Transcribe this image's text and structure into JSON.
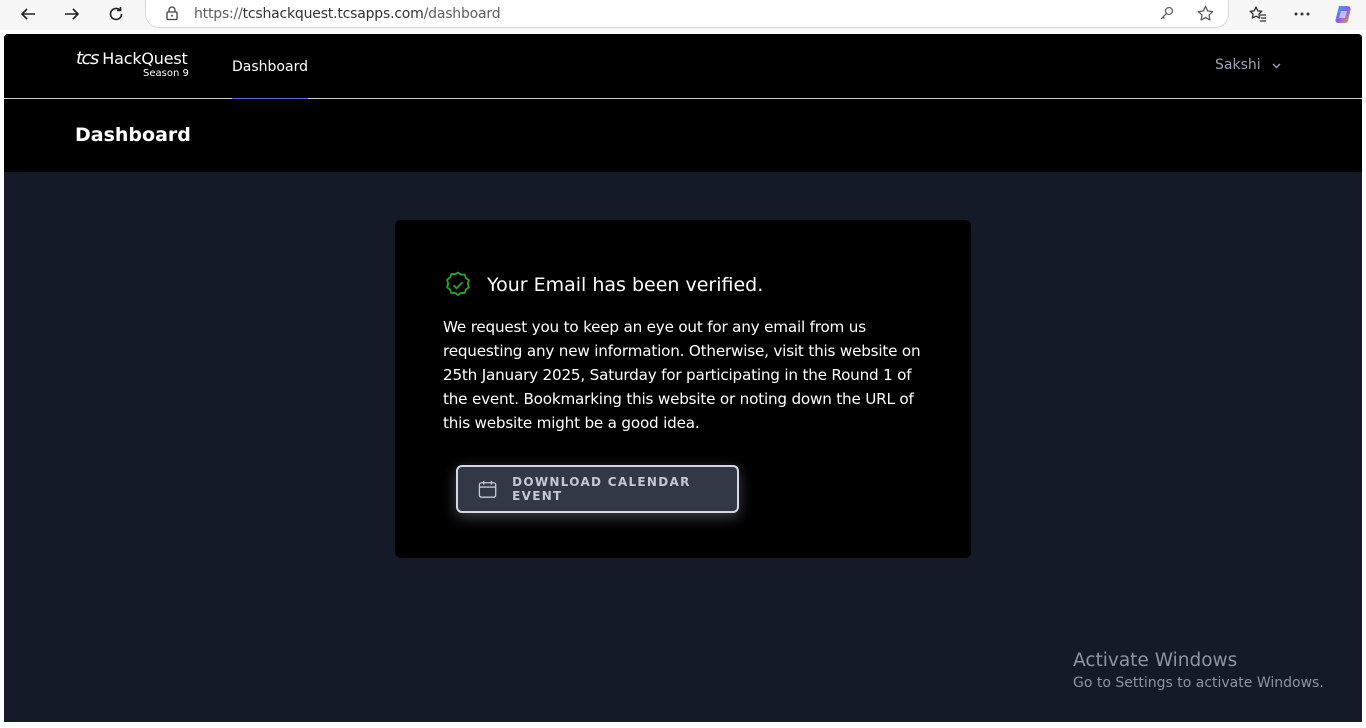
{
  "browser": {
    "url_prefix": "https://",
    "url_host": "tcshackquest.tcsapps.com",
    "url_path": "/dashboard"
  },
  "topnav": {
    "logo_brand": "tcs",
    "logo_name": "HackQuest",
    "logo_season": "Season 9",
    "nav_dashboard": "Dashboard",
    "user_name": "Sakshi"
  },
  "page": {
    "title": "Dashboard"
  },
  "card": {
    "title": "Your Email has been verified.",
    "body": "We request you to keep an eye out for any email from us requesting any new information. Otherwise, visit this website on 25th January 2025, Saturday for participating in the Round 1 of the event. Bookmarking this website or noting down the URL of this website might be a good idea.",
    "button_label": "DOWNLOAD CALENDAR EVENT",
    "check_color": "#22a82e"
  },
  "watermark": {
    "title": "Activate Windows",
    "subtitle": "Go to Settings to activate Windows."
  },
  "icons": {
    "back": "back-arrow-icon",
    "forward": "forward-arrow-icon",
    "refresh": "refresh-icon",
    "lock": "lock-icon",
    "key": "key-icon",
    "favorite": "star-icon",
    "favorites_list": "favorites-icon",
    "more": "more-icon",
    "copilot": "copilot-icon",
    "chevron": "chevron-down-icon",
    "verified": "verified-badge-icon",
    "calendar": "calendar-icon"
  }
}
